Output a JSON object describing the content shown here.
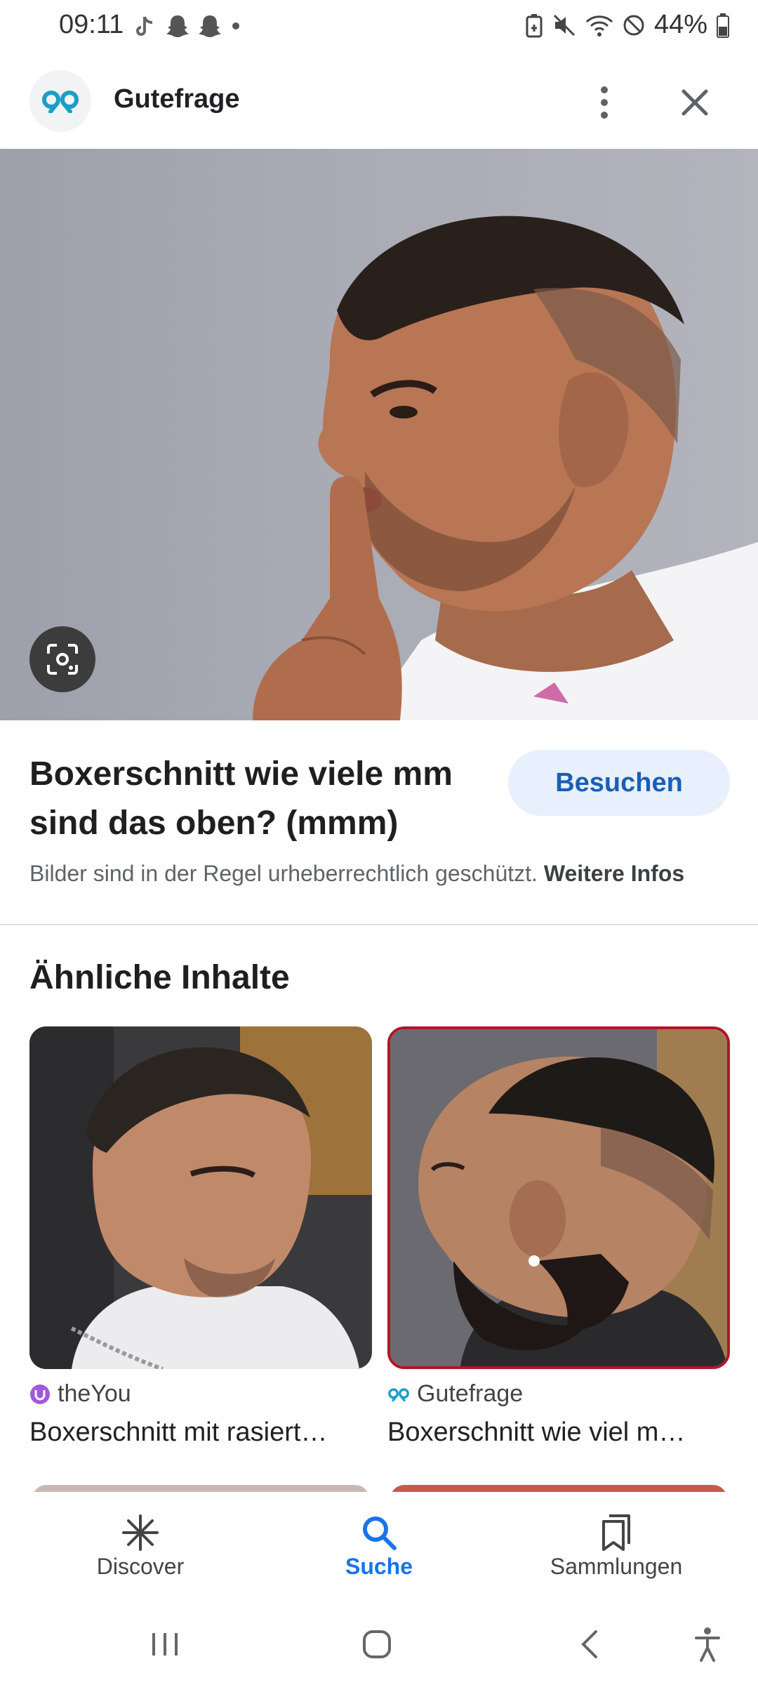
{
  "status_bar": {
    "time": "09:11",
    "battery": "44%",
    "left_icons": [
      "tiktok-icon",
      "snapchat-icon",
      "snapchat-icon",
      "dot-icon"
    ],
    "right_icons": [
      "battery-saver-icon",
      "mute-icon",
      "wifi-icon",
      "block-icon",
      "battery-icon"
    ]
  },
  "header": {
    "site_name": "Gutefrage",
    "more_icon": "more-vert-icon",
    "close_icon": "close-icon"
  },
  "image": {
    "title": "Boxerschnitt wie viele mm sind das oben? (mmm)",
    "visit_label": "Besuchen",
    "copyright_text": "Bilder sind in der Regel urheberrechtlich geschützt.",
    "more_info_label": "Weitere Infos"
  },
  "related": {
    "heading": "Ähnliche Inhalte",
    "items": [
      {
        "source": "theYou",
        "title": "Boxerschnitt mit rasiert…",
        "source_icon": "theyou-logo-icon"
      },
      {
        "source": "Gutefrage",
        "title": "Boxerschnitt wie viel m…",
        "source_icon": "gutefrage-logo-icon"
      }
    ]
  },
  "bottom_nav": {
    "items": [
      {
        "label": "Discover",
        "icon": "asterisk-icon",
        "active": false
      },
      {
        "label": "Suche",
        "icon": "search-icon",
        "active": true
      },
      {
        "label": "Sammlungen",
        "icon": "bookmarks-icon",
        "active": false
      }
    ]
  },
  "colors": {
    "accent": "#1a73e8",
    "visit_button_bg": "#e8f0fe",
    "gutefrage_teal": "#1c9ec4"
  }
}
